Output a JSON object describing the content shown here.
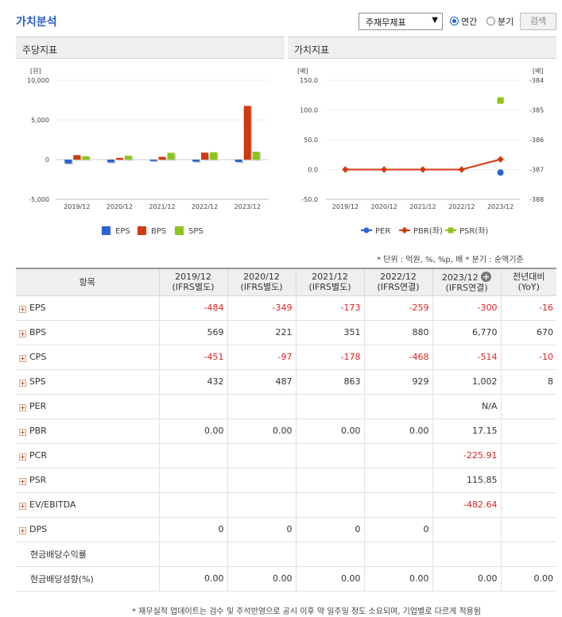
{
  "header": {
    "title": "가치분석",
    "dropdown_value": "주재무제표",
    "radio_annual": "연간",
    "radio_quarter": "분기",
    "search_button": "검색"
  },
  "left_panel": {
    "title": "주당지표"
  },
  "right_panel": {
    "title": "가치지표"
  },
  "chart_data": [
    {
      "type": "bar",
      "title": "주당지표",
      "ylabel": "[원]",
      "categories": [
        "2019/12",
        "2020/12",
        "2021/12",
        "2022/12",
        "2023/12"
      ],
      "ylim": [
        -5000,
        10000
      ],
      "yticks": [
        "10,000",
        "5,000",
        "0",
        "-5,000"
      ],
      "legend_position": "bottom",
      "series": [
        {
          "name": "EPS",
          "color": "#2a62d8",
          "values": [
            -484,
            -349,
            -173,
            -259,
            -300
          ]
        },
        {
          "name": "BPS",
          "color": "#d03a10",
          "values": [
            569,
            221,
            351,
            880,
            6770
          ]
        },
        {
          "name": "SPS",
          "color": "#8cc41c",
          "values": [
            432,
            487,
            863,
            929,
            1002
          ]
        }
      ]
    },
    {
      "type": "line",
      "title": "가치지표",
      "ylabel_left": "[배]",
      "ylabel_right": "[배]",
      "categories": [
        "2019/12",
        "2020/12",
        "2021/12",
        "2022/12",
        "2023/12"
      ],
      "ylim_left": [
        -50,
        150
      ],
      "yticks_left": [
        "150.0",
        "100.0",
        "50.0",
        "0.0",
        "-50.0"
      ],
      "ylim_right": [
        -388,
        -384
      ],
      "yticks_right": [
        "-384",
        "-385",
        "-386",
        "-387",
        "-388"
      ],
      "legend_position": "bottom",
      "series": [
        {
          "name": "PER",
          "axis": "right",
          "color": "#2a62d8",
          "values": [
            null,
            null,
            null,
            null,
            -387.1
          ]
        },
        {
          "name": "PBR(좌)",
          "axis": "left",
          "color": "#d03a10",
          "values": [
            0.0,
            0.0,
            0.0,
            0.0,
            17.15
          ]
        },
        {
          "name": "PSR(좌)",
          "axis": "left",
          "color": "#8cc41c",
          "values": [
            null,
            null,
            null,
            null,
            115.85
          ]
        }
      ]
    }
  ],
  "units_note": "* 단위 : 억원, %, %p, 배    * 분기 : 순액기준",
  "table": {
    "header_item": "항목",
    "columns": [
      {
        "line1": "2019/12",
        "line2": "(IFRS별도)"
      },
      {
        "line1": "2020/12",
        "line2": "(IFRS별도)"
      },
      {
        "line1": "2021/12",
        "line2": "(IFRS별도)"
      },
      {
        "line1": "2022/12",
        "line2": "(IFRS연결)"
      },
      {
        "line1": "2023/12",
        "line2": "(IFRS연결)"
      },
      {
        "line1": "전년대비",
        "line2": "(YoY)"
      }
    ],
    "rows": [
      {
        "label": "EPS",
        "expand": true,
        "cells": [
          "-484",
          "-349",
          "-173",
          "-259",
          "-300",
          "-16"
        ]
      },
      {
        "label": "BPS",
        "expand": true,
        "cells": [
          "569",
          "221",
          "351",
          "880",
          "6,770",
          "670"
        ]
      },
      {
        "label": "CPS",
        "expand": true,
        "cells": [
          "-451",
          "-97",
          "-178",
          "-468",
          "-514",
          "-10"
        ]
      },
      {
        "label": "SPS",
        "expand": true,
        "cells": [
          "432",
          "487",
          "863",
          "929",
          "1,002",
          "8"
        ]
      },
      {
        "label": "PER",
        "expand": true,
        "cells": [
          "",
          "",
          "",
          "",
          "N/A",
          ""
        ]
      },
      {
        "label": "PBR",
        "expand": true,
        "cells": [
          "0.00",
          "0.00",
          "0.00",
          "0.00",
          "17.15",
          ""
        ]
      },
      {
        "label": "PCR",
        "expand": true,
        "cells": [
          "",
          "",
          "",
          "",
          "-225.91",
          ""
        ]
      },
      {
        "label": "PSR",
        "expand": true,
        "cells": [
          "",
          "",
          "",
          "",
          "115.85",
          ""
        ]
      },
      {
        "label": "EV/EBITDA",
        "expand": true,
        "cells": [
          "",
          "",
          "",
          "",
          "-482.64",
          ""
        ]
      },
      {
        "label": "DPS",
        "expand": true,
        "cells": [
          "0",
          "0",
          "0",
          "0",
          "",
          ""
        ]
      },
      {
        "label": "현금배당수익률",
        "expand": false,
        "cells": [
          "",
          "",
          "",
          "",
          "",
          ""
        ]
      },
      {
        "label": "현금배당성향(%)",
        "expand": false,
        "cells": [
          "0.00",
          "0.00",
          "0.00",
          "0.00",
          "0.00",
          "0.00"
        ]
      }
    ]
  },
  "bottom_note": "* 재무실적 업데이트는 검수 및 주석반영으로 공시 이후 약 일주일 정도 소요되며, 기업별로 다르게 적용됨"
}
